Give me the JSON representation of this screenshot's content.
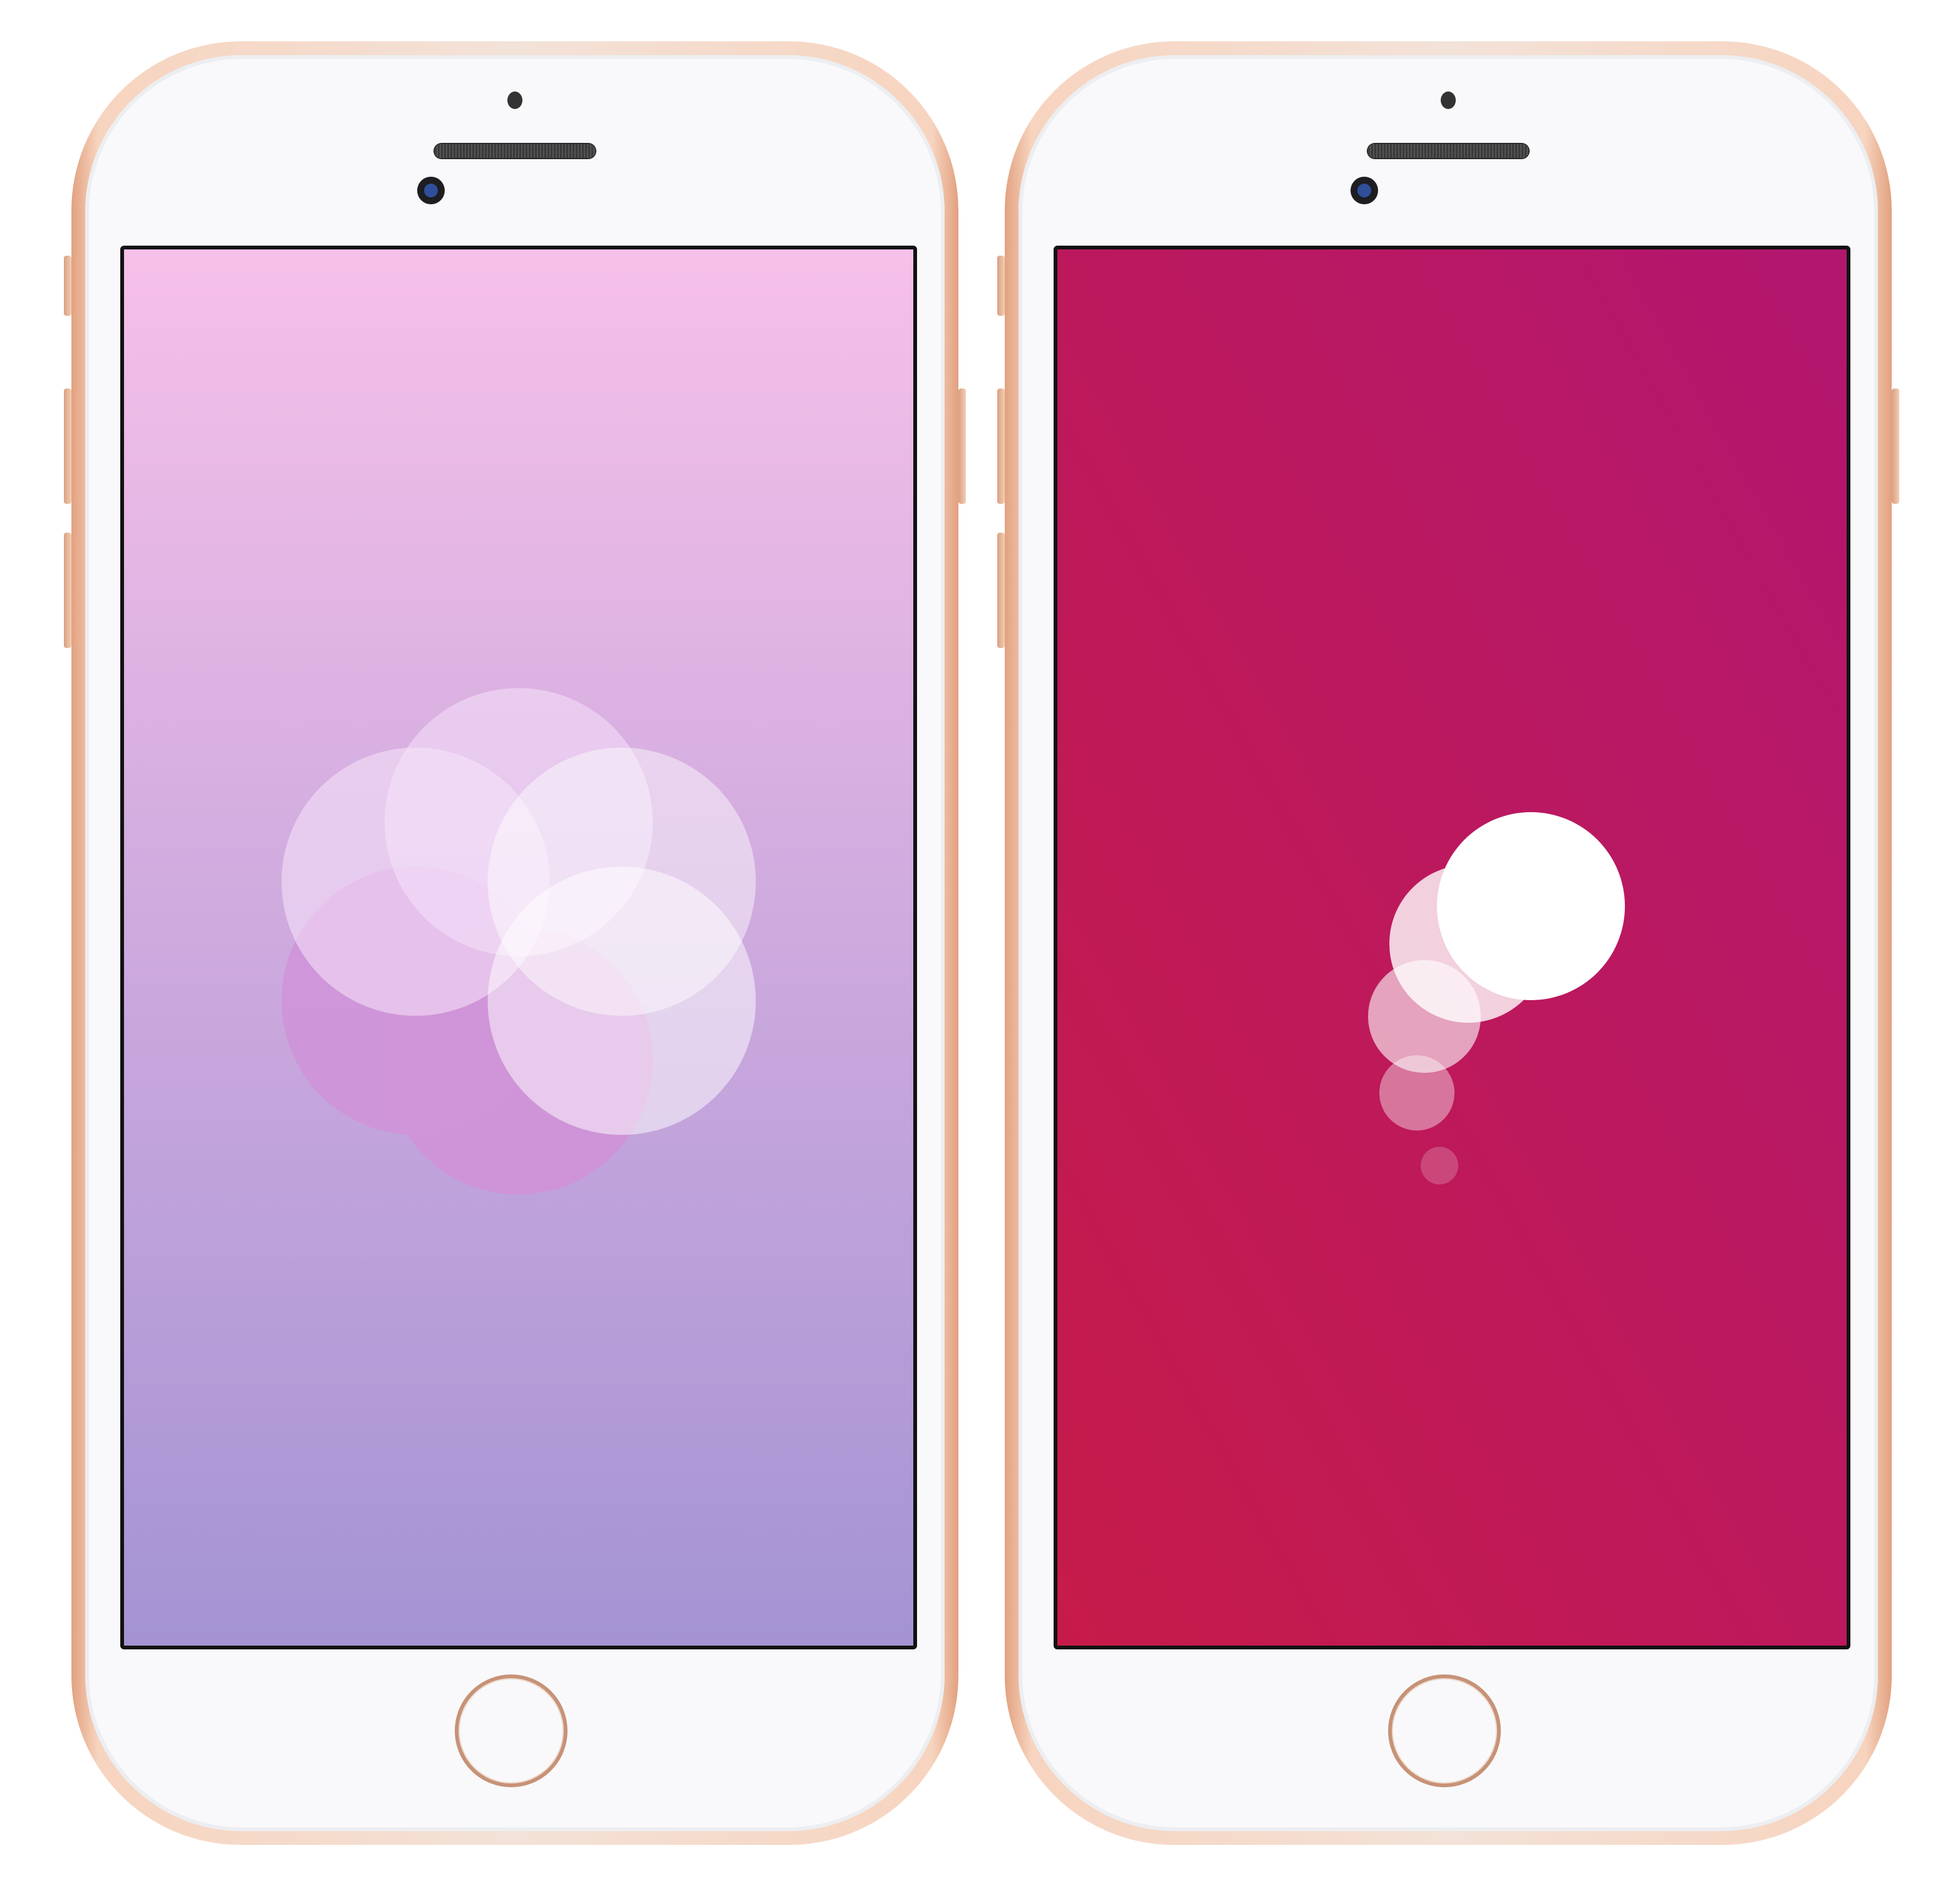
{
  "phones": [
    {
      "frame_color": "#e2a17f",
      "screen": {
        "background_top": "#f6c0e9",
        "background_bottom": "#a493d3",
        "icon": "flower-icon",
        "petal_colors": [
          "#cf94d8",
          "#f8e6fb",
          "#ffffff"
        ]
      }
    },
    {
      "frame_color": "#e2a17f",
      "screen": {
        "background_top_right": "#b2166f",
        "background_bottom_left": "#c61b4a",
        "icon": "bubbles-icon",
        "bubble_color": "#ffffff",
        "bubble_opacities": [
          1,
          0.8,
          0.6,
          0.4,
          0.2
        ]
      }
    }
  ]
}
